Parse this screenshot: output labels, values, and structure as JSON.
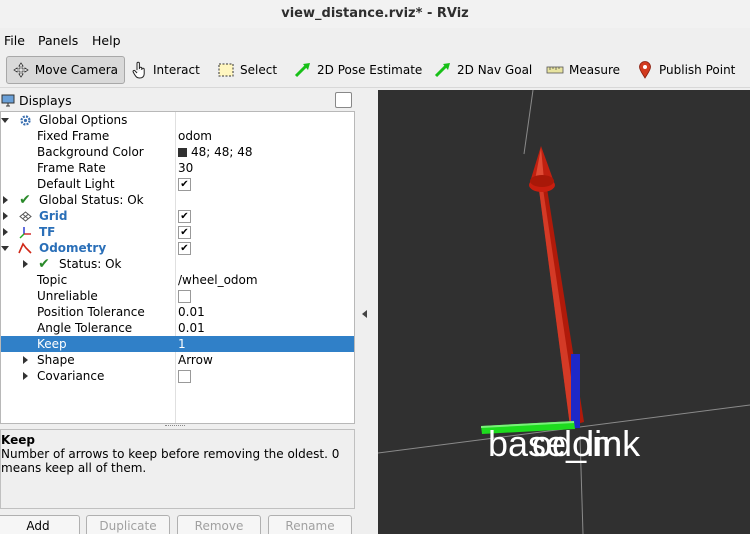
{
  "window": {
    "title": "view_distance.rviz* - RViz"
  },
  "menu": [
    {
      "label": "File"
    },
    {
      "label": "Panels"
    },
    {
      "label": "Help"
    }
  ],
  "toolbar": {
    "move_camera": "Move Camera",
    "interact": "Interact",
    "select": "Select",
    "pose_estimate": "2D Pose Estimate",
    "nav_goal": "2D Nav Goal",
    "measure": "Measure",
    "publish_point": "Publish Point"
  },
  "displays": {
    "title": "Displays",
    "rows": [
      {
        "label": "Global Options"
      },
      {
        "label": "Fixed Frame",
        "value": "odom"
      },
      {
        "label": "Background Color",
        "value": "48; 48; 48"
      },
      {
        "label": "Frame Rate",
        "value": "30"
      },
      {
        "label": "Default Light"
      },
      {
        "label": "Global Status: Ok"
      },
      {
        "label": "Grid"
      },
      {
        "label": "TF"
      },
      {
        "label": "Odometry"
      },
      {
        "label": "Status: Ok"
      },
      {
        "label": "Topic",
        "value": "/wheel_odom"
      },
      {
        "label": "Unreliable"
      },
      {
        "label": "Position Tolerance",
        "value": "0.01"
      },
      {
        "label": "Angle Tolerance",
        "value": "0.01"
      },
      {
        "label": "Keep",
        "value": "1"
      },
      {
        "label": "Shape",
        "value": "Arrow"
      },
      {
        "label": "Covariance"
      }
    ]
  },
  "help": {
    "title": "Keep",
    "text": "Number of arrows to keep before removing the oldest. 0 means keep all of them."
  },
  "buttons": {
    "add": "Add",
    "duplicate": "Duplicate",
    "remove": "Remove",
    "rename": "Rename"
  },
  "viewport": {
    "frame_label": "base_link",
    "overlap_label": "odom",
    "background": "#303030"
  },
  "colors": {
    "selection": "#3080c8",
    "display_name": "#2a6fb8",
    "arrow_red": "#c81e0f",
    "axis_blue": "#1e28c8",
    "axis_green": "#1edc1e"
  }
}
